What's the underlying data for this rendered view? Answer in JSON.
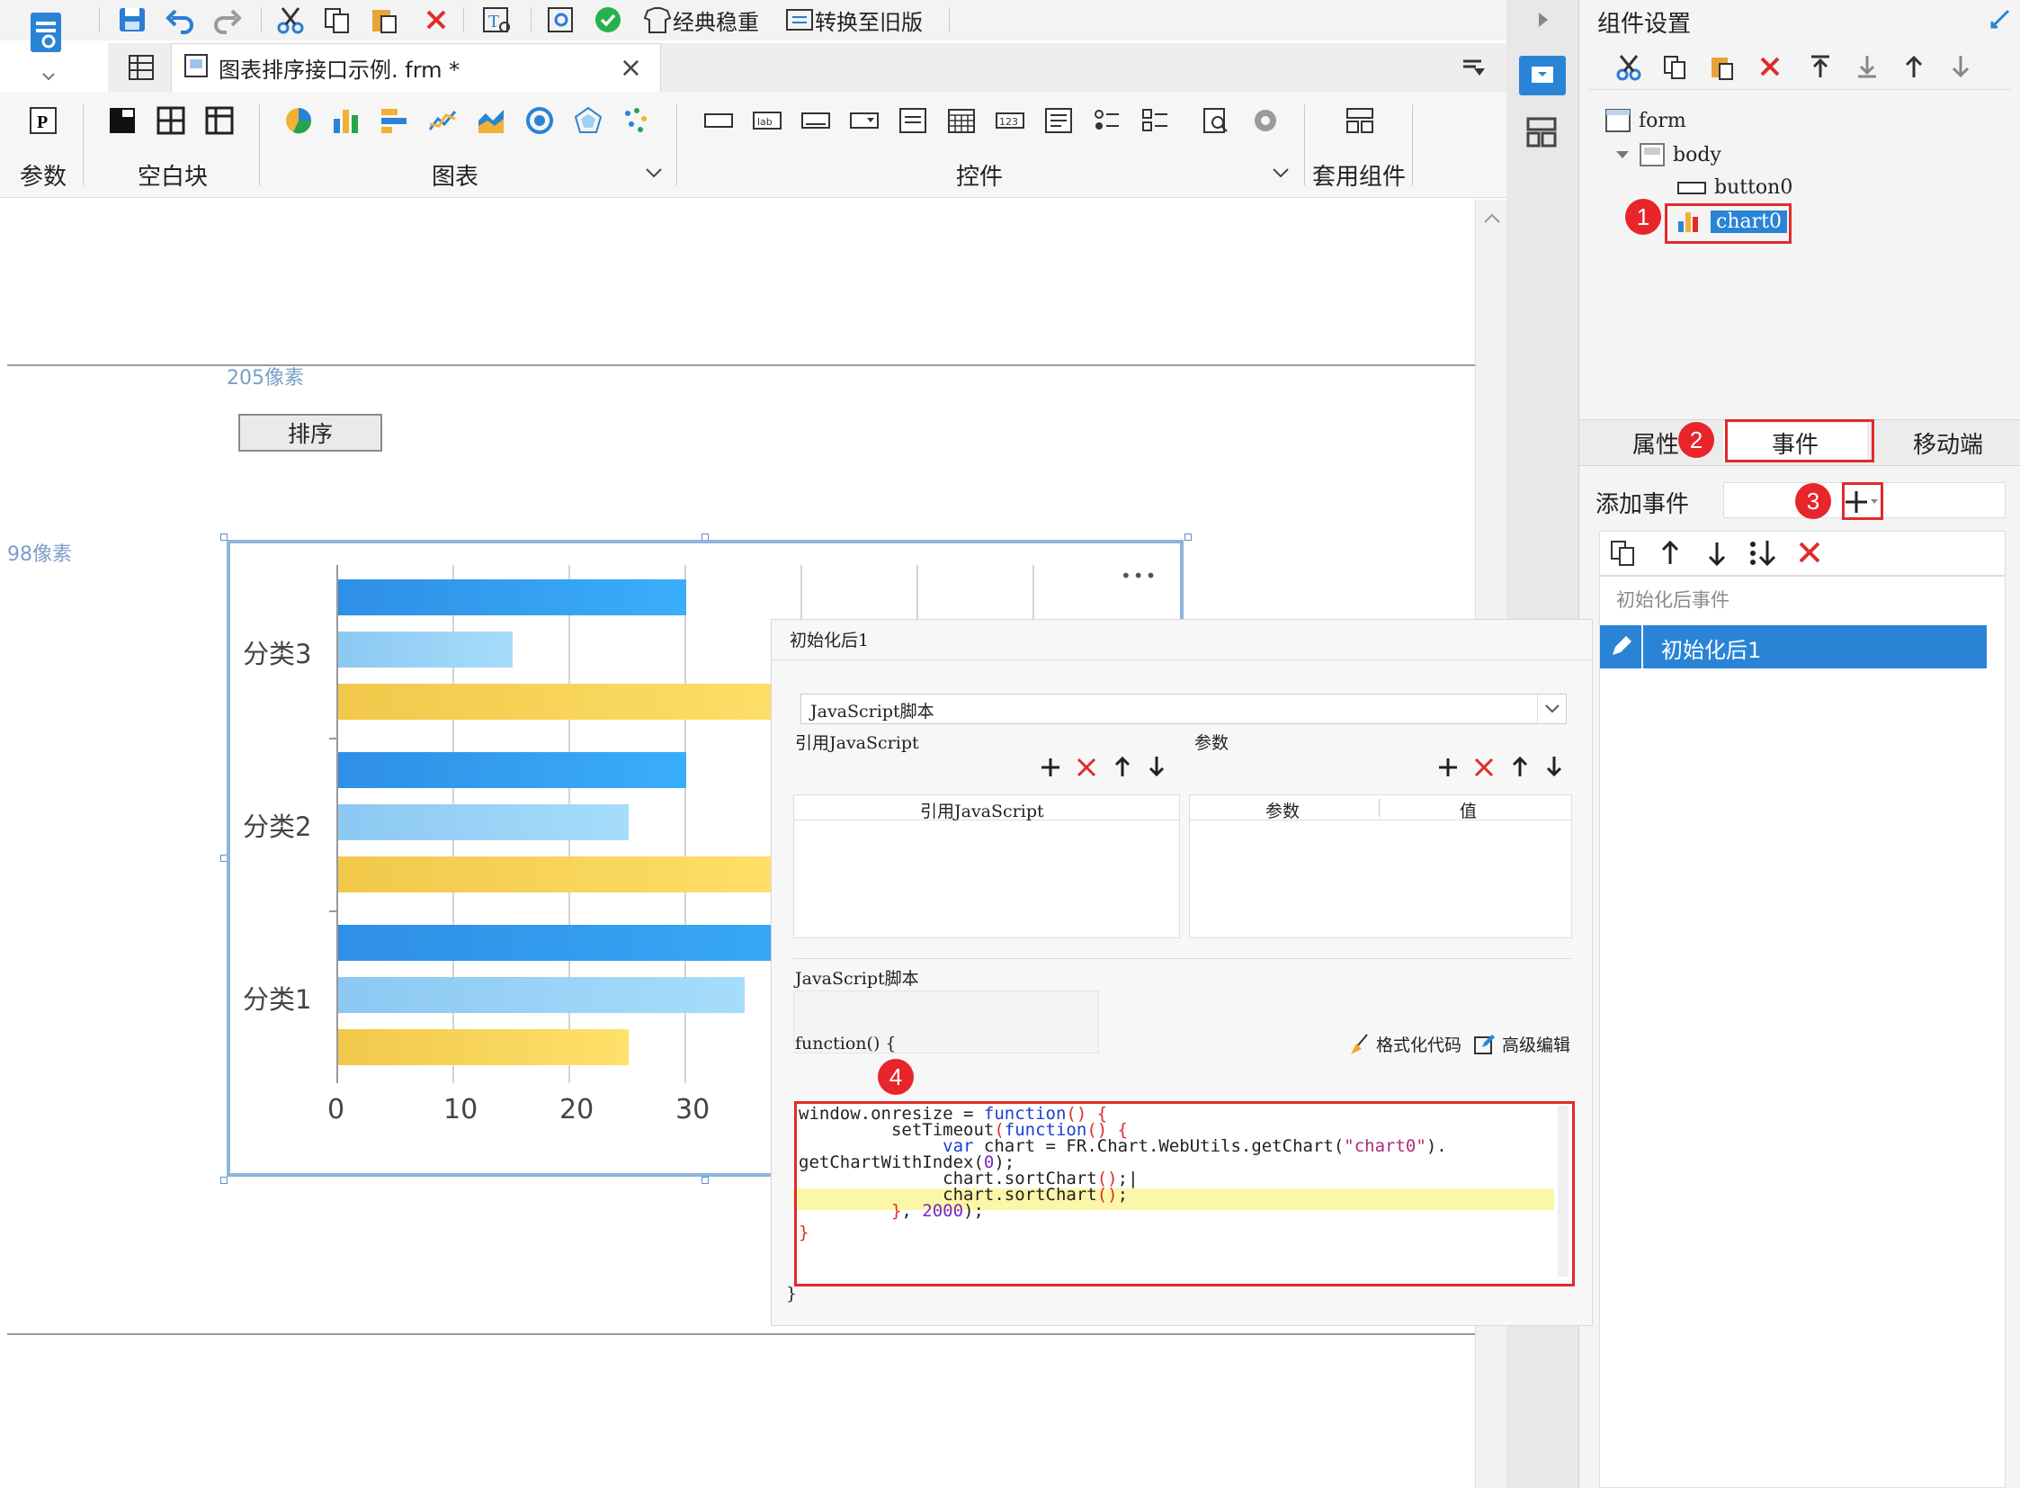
{
  "toolbar": {
    "classic_style": "经典稳重",
    "convert_old": "转换至旧版"
  },
  "tab": {
    "title": "图表排序接口示例. frm *",
    "close": "×"
  },
  "ribbon": {
    "param": "参数",
    "blank_block": "空白块",
    "chart": "图表",
    "widgets": "控件",
    "applied": "套用组件"
  },
  "canvas": {
    "width_label": "205像素",
    "height_label": "98像素",
    "sort_button": "排序"
  },
  "chart_data": {
    "type": "bar",
    "orientation": "horizontal",
    "categories": [
      "分类1",
      "分类2",
      "分类3"
    ],
    "series": [
      {
        "values": [
          48,
          30,
          30
        ],
        "color": "#2e9af0"
      },
      {
        "values": [
          35,
          25,
          15
        ],
        "color": "#95d2f7"
      },
      {
        "values": [
          25,
          40,
          42
        ],
        "color": "#f4d257"
      }
    ],
    "xticks": [
      "0",
      "10",
      "20",
      "30"
    ],
    "more": "•••"
  },
  "right_panel": {
    "title": "组件设置",
    "tree": {
      "form": "form",
      "body": "body",
      "button": "button0",
      "chart": "chart0"
    },
    "tabs": {
      "props": "属性",
      "events": "事件",
      "mobile": "移动端"
    },
    "add_event_label": "添加事件",
    "event_group": "初始化后事件",
    "event_item": "初始化后1"
  },
  "dialog": {
    "title": "初始化后1",
    "script_type": "JavaScript脚本",
    "ref_js_label": "引用JavaScript",
    "param_label": "参数",
    "ref_js_col": "引用JavaScript",
    "param_col": "参数",
    "value_col": "值",
    "js_script_label": "JavaScript脚本",
    "func_open": "function() {",
    "format_code": "格式化代码",
    "advanced_edit": "高级编辑",
    "func_close": "}"
  },
  "badges": [
    "1",
    "2",
    "3",
    "4"
  ]
}
